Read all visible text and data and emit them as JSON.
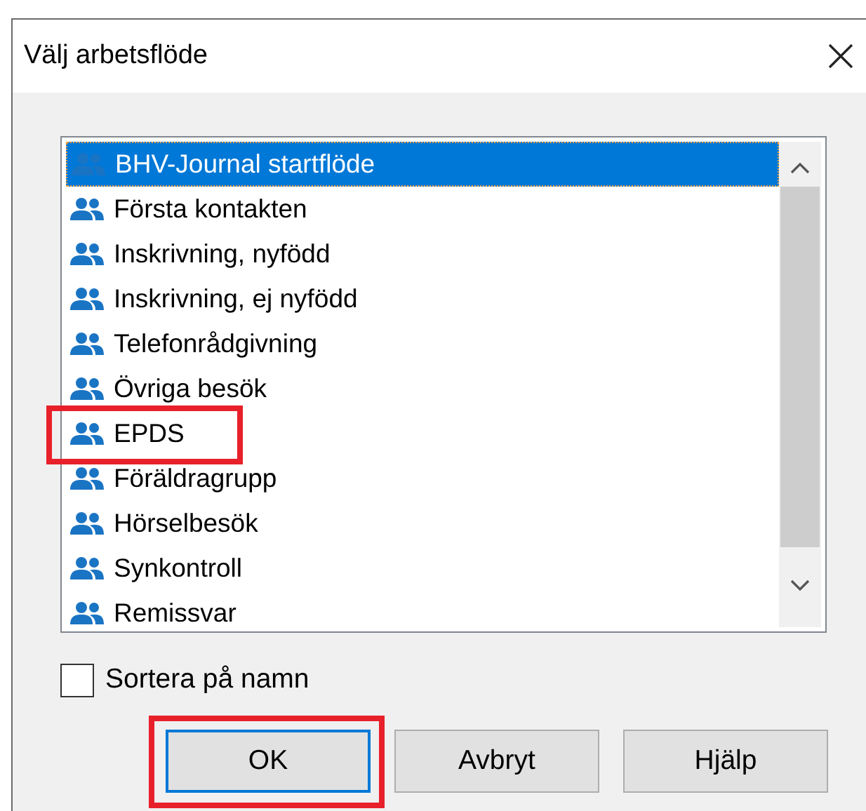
{
  "window": {
    "title": "Välj arbetsflöde"
  },
  "list": {
    "items": [
      {
        "label": "BHV-Journal startflöde",
        "selected": true,
        "highlighted": false
      },
      {
        "label": "Första kontakten",
        "selected": false,
        "highlighted": false
      },
      {
        "label": "Inskrivning, nyfödd",
        "selected": false,
        "highlighted": false
      },
      {
        "label": "Inskrivning, ej nyfödd",
        "selected": false,
        "highlighted": false
      },
      {
        "label": "Telefonrådgivning",
        "selected": false,
        "highlighted": false
      },
      {
        "label": "Övriga besök",
        "selected": false,
        "highlighted": false
      },
      {
        "label": "EPDS",
        "selected": false,
        "highlighted": true
      },
      {
        "label": "Föräldragrupp",
        "selected": false,
        "highlighted": false
      },
      {
        "label": "Hörselbesök",
        "selected": false,
        "highlighted": false
      },
      {
        "label": "Synkontroll",
        "selected": false,
        "highlighted": false
      },
      {
        "label": "Remissvar",
        "selected": false,
        "highlighted": false
      }
    ]
  },
  "sort_checkbox": {
    "label": "Sortera på namn",
    "checked": false
  },
  "buttons": [
    {
      "label": "OK",
      "default": true,
      "highlighted": true
    },
    {
      "label": "Avbryt",
      "default": false,
      "highlighted": false
    },
    {
      "label": "Hjälp",
      "default": false,
      "highlighted": false
    }
  ]
}
